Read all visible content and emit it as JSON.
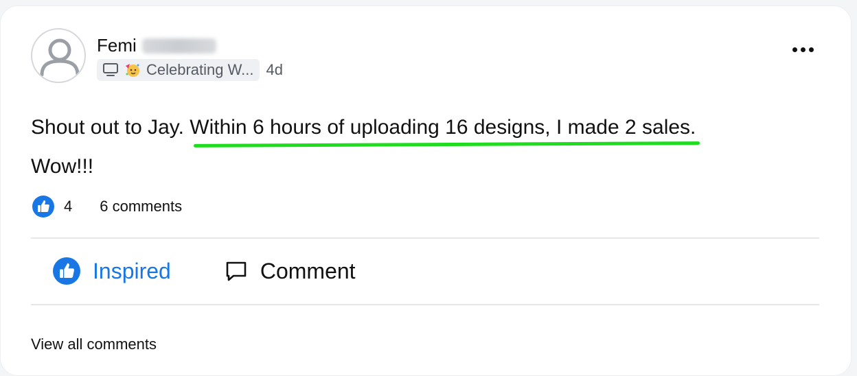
{
  "post": {
    "author_first": "Femi",
    "space_name": "Celebrating W...",
    "time_ago": "4d",
    "body_intro": "Shout out to Jay. ",
    "body_highlight": "Within 6 hours of uploading 16 designs, I made 2 sales.",
    "body_end": "Wow!!!"
  },
  "stats": {
    "like_count": "4",
    "comments_label": "6 comments"
  },
  "actions": {
    "inspired_label": "Inspired",
    "comment_label": "Comment"
  },
  "footer": {
    "view_all_label": "View all comments"
  },
  "colors": {
    "accent": "#1877e5",
    "highlight_underline": "#1fdc1f"
  },
  "icons": {
    "avatar": "default-user-icon",
    "space": "monitor-icon",
    "space_emoji": "party-face-emoji",
    "more": "more-horizontal-icon",
    "like": "thumbs-up-icon",
    "comment": "speech-bubble-icon"
  }
}
